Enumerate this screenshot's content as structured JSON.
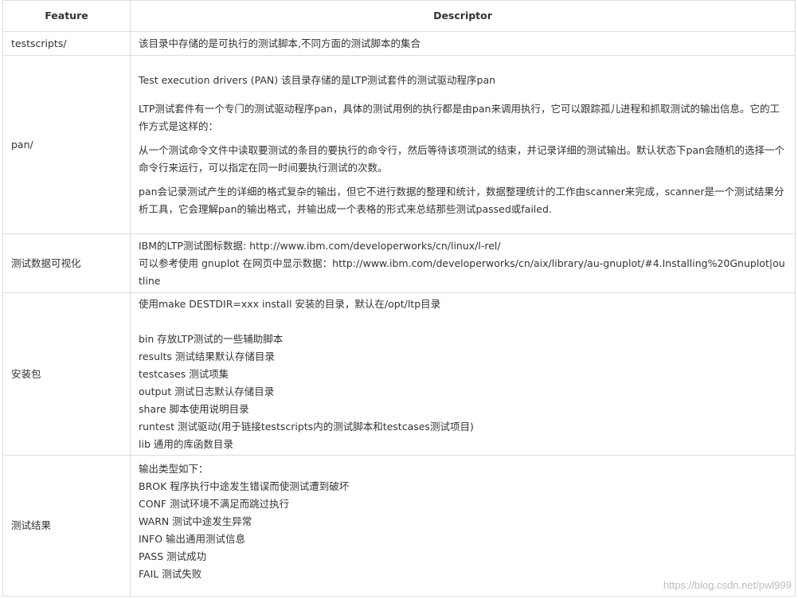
{
  "table": {
    "headers": {
      "feature": "Feature",
      "descriptor": "Descriptor"
    },
    "rows": {
      "testscripts": {
        "feature": "testscripts/",
        "desc": "该目录中存储的是可执行的测试脚本,不同方面的测试脚本的集合"
      },
      "pan": {
        "feature": "pan/",
        "p1": "Test execution drivers (PAN) 该目录存储的是LTP测试套件的测试驱动程序pan",
        "p2": "LTP测试套件有一个专门的测试驱动程序pan，具体的测试用例的执行都是由pan来调用执行，它可以跟踪孤儿进程和抓取测试的输出信息。它的工作方式是这样的：",
        "p3": "从一个测试命令文件中读取要测试的条目的要执行的命令行，然后等待该项测试的结束，并记录详细的测试输出。默认状态下pan会随机的选择一个命令行来运行，可以指定在同一时间要执行测试的次数。",
        "p4": "pan会记录测试产生的详细的格式复杂的输出，但它不进行数据的整理和统计，数据整理统计的工作由scanner来完成，scanner是一个测试结果分析工具，它会理解pan的输出格式，并输出成一个表格的形式来总结那些测试passed或failed."
      },
      "viz": {
        "feature": "测试数据可视化",
        "line1": "IBM的LTP测试图标数据: http://www.ibm.com/developerworks/cn/linux/l-rel/",
        "line2": "可以参考使用 gnuplot 在网页中显示数据：http://www.ibm.com/developerworks/cn/aix/library/au-gnuplot/#4.Installing%20Gnuplot|outline"
      },
      "install": {
        "feature": "安装包",
        "intro": "使用make DESTDIR=xxx install 安装的目录，默认在/opt/ltp目录",
        "items": [
          "bin 存放LTP测试的一些辅助脚本",
          "results 测试结果默认存储目录",
          "testcases 测试项集",
          "output 测试日志默认存储目录",
          "share 脚本使用说明目录",
          "runtest 测试驱动(用于链接testscripts内的测试脚本和testcases测试项目)",
          "lib 通用的库函数目录"
        ]
      },
      "results": {
        "feature": "测试结果",
        "intro": "输出类型如下：",
        "items": [
          "BROK 程序执行中途发生错误而使测试遭到破坏",
          "CONF 测试环境不满足而跳过执行",
          "WARN 测试中途发生异常",
          "INFO 输出通用测试信息",
          "PASS 测试成功",
          "FAIL 测试失败"
        ]
      }
    }
  },
  "watermark": "https://blog.csdn.net/pwl999"
}
